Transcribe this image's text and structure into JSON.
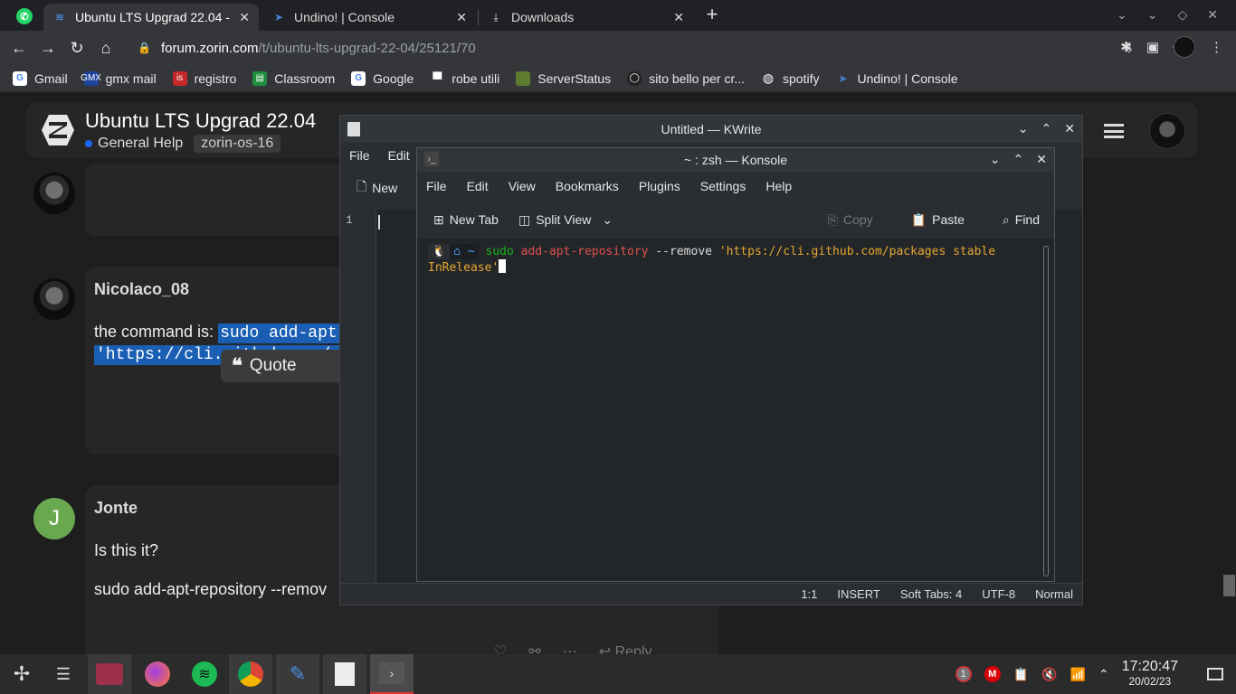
{
  "browser": {
    "tabs": [
      {
        "title": "Ubuntu LTS Upgrad 22.04 -",
        "active": true
      },
      {
        "title": "Undino! | Console",
        "active": false
      },
      {
        "title": "Downloads",
        "active": false
      }
    ],
    "new_tab_icon": "plus-icon",
    "url_host": "forum.zorin.com",
    "url_path": "/t/ubuntu-lts-upgrad-22-04/25121/70",
    "bookmarks": [
      "Gmail",
      "gmx mail",
      "registro",
      "Classroom",
      "Google",
      "robe utili",
      "ServerStatus",
      "sito bello per cr...",
      "spotify",
      "Undino! | Console"
    ]
  },
  "forum": {
    "topic_title": "Ubuntu LTS Upgrad 22.04",
    "category": "General Help",
    "tag": "zorin-os-16",
    "posts": [
      {
        "username": "Nicolaco_08",
        "text_prefix": "the command is: ",
        "code_line1": "sudo add-apt-",
        "code_line2": "'https://cli.github.com/pa"
      },
      {
        "username": "Jonte",
        "avatar_letter": "J",
        "line1": "Is this it?",
        "line2": "sudo add-apt-repository --remov"
      }
    ],
    "quote_label": "Quote",
    "reply_label": "Reply"
  },
  "kwrite": {
    "title": "Untitled — KWrite",
    "menu": [
      "File",
      "Edit"
    ],
    "toolbar_new": "New",
    "line_number": "1",
    "status": [
      "1:1",
      "INSERT",
      "Soft Tabs: 4",
      "UTF-8",
      "Normal"
    ]
  },
  "konsole": {
    "title": "~ : zsh — Konsole",
    "menu": [
      "File",
      "Edit",
      "View",
      "Bookmarks",
      "Plugins",
      "Settings",
      "Help"
    ],
    "toolbar": {
      "new_tab": "New Tab",
      "split_view": "Split View",
      "copy": "Copy",
      "paste": "Paste",
      "find": "Find"
    },
    "prompt_dir": "~",
    "cmd": "sudo",
    "bin": "add-apt-repository",
    "arg": "--remove",
    "string_line1": "'https://cli.github.com/packages stable",
    "string_line2": "InRelease'"
  },
  "taskbar": {
    "time": "17:20:47",
    "date": "20/02/23",
    "notification_count": "1"
  },
  "colors": {
    "accent": "#1a5fb4",
    "terminal_green": "#18b218",
    "terminal_red": "#e05050",
    "terminal_string": "#e5a632"
  }
}
